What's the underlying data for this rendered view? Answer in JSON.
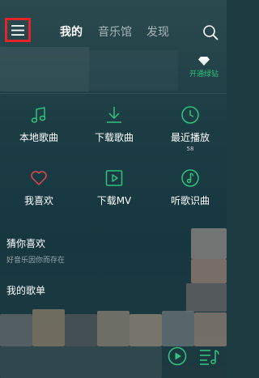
{
  "header": {
    "menu_icon": "hamburger-menu-icon",
    "tabs": [
      {
        "label": "我的",
        "active": true
      },
      {
        "label": "音乐馆",
        "active": false
      },
      {
        "label": "发现",
        "active": false
      }
    ],
    "search_icon": "search-icon"
  },
  "vip": {
    "label": "开通绿钻",
    "icon": "diamond-icon"
  },
  "grid": [
    {
      "label": "本地歌曲",
      "icon": "music-note-icon"
    },
    {
      "label": "下载歌曲",
      "icon": "download-icon"
    },
    {
      "label": "最近播放",
      "icon": "clock-icon",
      "count": "58"
    },
    {
      "label": "我喜欢",
      "icon": "heart-icon"
    },
    {
      "label": "下载MV",
      "icon": "video-play-icon"
    },
    {
      "label": "听歌识曲",
      "icon": "music-recognition-icon"
    }
  ],
  "guess": {
    "title": "猜你喜欢",
    "subtitle": "好音乐因你而存在"
  },
  "playlists": {
    "title": "我的歌单"
  },
  "player": {
    "play_icon": "play-icon",
    "queue_icon": "playlist-queue-icon"
  },
  "colors": {
    "accent": "#31c27c",
    "highlight": "#e3242b",
    "background": "#1c3c44"
  }
}
